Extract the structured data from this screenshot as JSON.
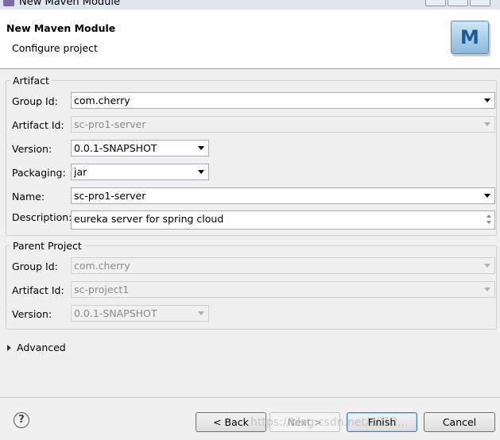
{
  "window": {
    "title": "New Maven Module"
  },
  "header": {
    "title": "New Maven Module",
    "subtitle": "Configure project",
    "logo_letter": "M"
  },
  "artifact": {
    "title": "Artifact",
    "group_id": {
      "label": "Group Id:",
      "value": "com.cherry"
    },
    "artifact_id": {
      "label": "Artifact Id:",
      "value": "sc-pro1-server"
    },
    "version": {
      "label": "Version:",
      "value": "0.0.1-SNAPSHOT"
    },
    "packaging": {
      "label": "Packaging:",
      "value": "jar"
    },
    "name": {
      "label": "Name:",
      "value": "sc-pro1-server"
    },
    "description": {
      "label": "Description:",
      "value": "eureka server for spring cloud"
    }
  },
  "parent": {
    "title": "Parent Project",
    "group_id": {
      "label": "Group Id:",
      "value": "com.cherry"
    },
    "artifact_id": {
      "label": "Artifact Id:",
      "value": "sc-project1"
    },
    "version": {
      "label": "Version:",
      "value": "0.0.1-SNAPSHOT"
    }
  },
  "advanced": {
    "label": "Advanced"
  },
  "buttons": {
    "back": "< Back",
    "next": "Next >",
    "finish": "Finish",
    "cancel": "Cancel",
    "help": "?"
  },
  "watermark": "https://blog.csdn.net/u012..."
}
